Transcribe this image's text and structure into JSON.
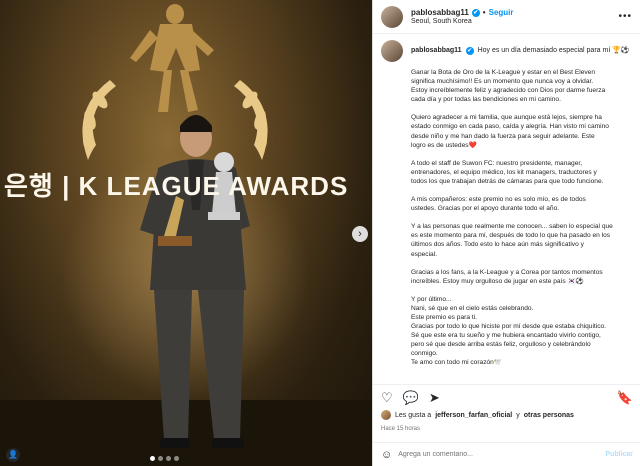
{
  "photo": {
    "banner_text": "은행 | K LEAGUE AWARDS",
    "next_glyph": "›",
    "tag_glyph": "👤",
    "dots_count": 4
  },
  "header": {
    "username": "pablosabbag11",
    "verified_glyph": "✔",
    "separator": "•",
    "follow_label": "Seguir",
    "location": "Seoul, South Korea",
    "more_glyph": "•••"
  },
  "caption": {
    "username": "pablosabbag11",
    "verified_glyph": "✔",
    "first_line": "Hoy es un día demasiado especial para mí 🏆⚽",
    "paragraphs": [
      [
        "Ganar la Bota de Oro de la K-League y estar en el Best Eleven",
        "significa muchísimo!! Es un momento que nunca voy a olvidar.",
        "Estoy increíblemente feliz y agradecido con Dios por darme fuerza",
        "cada día y por todas las bendiciones en mi camino."
      ],
      [
        "Quiero agradecer a mi familia, que aunque está lejos, siempre ha",
        "estado conmigo en cada paso, caída y alegría. Han visto mi camino",
        "desde niño y me han dado la fuerza para seguir adelante. Este",
        "logro es de ustedes❤️"
      ],
      [
        "A todo el staff de Suwon FC: nuestro presidente, manager,",
        "entrenadores, el equipo médico, los kit managers, traductores y",
        "todos los que trabajan detrás de cámaras para que todo funcione."
      ],
      [
        "A mis compañeros: este premio no es solo mío, es de todos",
        "ustedes. Gracias por el apoyo durante todo el año."
      ],
      [
        "Y a las personas que realmente me conocen... saben lo especial que",
        "es este momento para mí, después de todo lo que ha pasado en los",
        "últimos dos años. Todo esto lo hace aún más significativo y",
        "especial."
      ],
      [
        "Gracias a los fans, a la K-League y a Corea por tantos momentos",
        "increíbles. Estoy muy orgulloso de jugar en este país 🇰🇷⚽"
      ],
      [
        "Y por último...",
        "Nani, sé que en el cielo estás celebrando.",
        "Este premio es para ti.",
        "Gracias por todo lo que hiciste por mí desde que estaba chiquitico.",
        "Sé que este era tu sueño y me hubiera encantado vivirlo contigo,",
        "pero sé que desde arriba estás feliz, orgulloso y celebrándolo",
        "conmigo.",
        "Te amo con todo mi corazón🕊️"
      ]
    ]
  },
  "actions": {
    "like_glyph": "♡",
    "comment_glyph": "💬",
    "share_glyph": "➤",
    "save_glyph": "🔖"
  },
  "likes": {
    "prefix": "Les gusta a",
    "user": "jefferson_farfan_oficial",
    "middle": "y",
    "others": "otras personas"
  },
  "time_ago": "Hace 15 horas",
  "comment": {
    "emoji_glyph": "☺",
    "placeholder": "Agrega un comentario...",
    "publish_label": "Publicar"
  }
}
